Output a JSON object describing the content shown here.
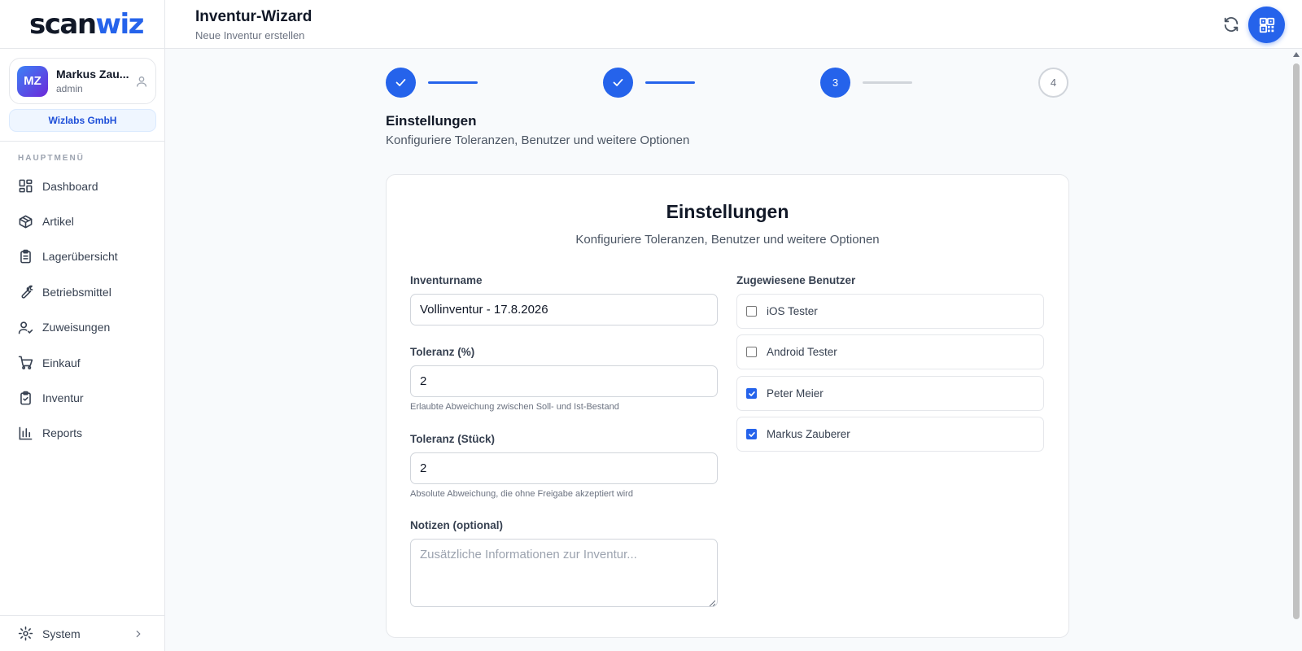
{
  "logo": {
    "part1": "scan",
    "part2": "wiz"
  },
  "user": {
    "initials": "MZ",
    "name": "Markus Zau...",
    "role": "admin"
  },
  "company": "Wizlabs GmbH",
  "sidebar": {
    "section_label": "HAUPTMENÜ",
    "items": [
      {
        "label": "Dashboard",
        "icon": "dashboard-icon"
      },
      {
        "label": "Artikel",
        "icon": "box-icon"
      },
      {
        "label": "Lagerübersicht",
        "icon": "clipboard-list-icon"
      },
      {
        "label": "Betriebsmittel",
        "icon": "wrench-icon"
      },
      {
        "label": "Zuweisungen",
        "icon": "user-check-icon"
      },
      {
        "label": "Einkauf",
        "icon": "cart-icon"
      },
      {
        "label": "Inventur",
        "icon": "clipboard-check-icon"
      },
      {
        "label": "Reports",
        "icon": "bar-chart-icon"
      }
    ],
    "system_label": "System"
  },
  "header": {
    "title": "Inventur-Wizard",
    "subtitle": "Neue Inventur erstellen"
  },
  "stepper": {
    "steps": [
      {
        "label": "",
        "state": "done"
      },
      {
        "label": "",
        "state": "done"
      },
      {
        "label": "3",
        "state": "active"
      },
      {
        "label": "4",
        "state": "todo"
      }
    ]
  },
  "section": {
    "title": "Einstellungen",
    "subtitle": "Konfiguriere Toleranzen, Benutzer und weitere Optionen"
  },
  "card": {
    "title": "Einstellungen",
    "subtitle": "Konfiguriere Toleranzen, Benutzer und weitere Optionen",
    "inventory_name": {
      "label": "Inventurname",
      "value": "Vollinventur - 17.8.2026"
    },
    "tolerance_percent": {
      "label": "Toleranz (%)",
      "value": "2",
      "help": "Erlaubte Abweichung zwischen Soll- und Ist-Bestand"
    },
    "tolerance_pieces": {
      "label": "Toleranz (Stück)",
      "value": "2",
      "help": "Absolute Abweichung, die ohne Freigabe akzeptiert wird"
    },
    "notes": {
      "label": "Notizen (optional)",
      "placeholder": "Zusätzliche Informationen zur Inventur..."
    },
    "assigned_users": {
      "label": "Zugewiesene Benutzer",
      "users": [
        {
          "name": "iOS Tester",
          "checked": false
        },
        {
          "name": "Android Tester",
          "checked": false
        },
        {
          "name": "Peter Meier",
          "checked": true
        },
        {
          "name": "Markus Zauberer",
          "checked": true
        }
      ]
    }
  },
  "colors": {
    "accent": "#2563eb",
    "border": "#e5e7eb",
    "muted": "#6b7280"
  }
}
